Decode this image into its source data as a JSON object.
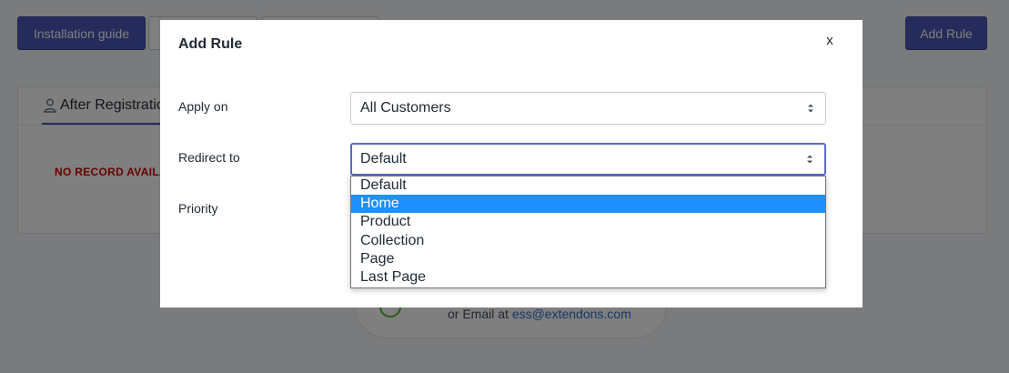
{
  "background": {
    "installation_guide_label": "Installation guide",
    "add_rule_label": "Add Rule",
    "tab_label": "After Registration",
    "no_record_text": "NO RECORD AVAILABLE",
    "support_text": "or Email at ",
    "support_email": "ess@extendons.com"
  },
  "modal": {
    "title": "Add Rule",
    "close_label": "x",
    "apply_on_label": "Apply on",
    "apply_on_value": "All Customers",
    "redirect_to_label": "Redirect to",
    "redirect_to_value": "Default",
    "priority_label": "Priority"
  },
  "dropdown": {
    "options": [
      "Default",
      "Home",
      "Product",
      "Collection",
      "Page",
      "Last Page"
    ],
    "highlighted": "Home"
  },
  "colors": {
    "primary": "#4a56b5",
    "highlight": "#1e90ff",
    "error_text": "#d40000"
  }
}
